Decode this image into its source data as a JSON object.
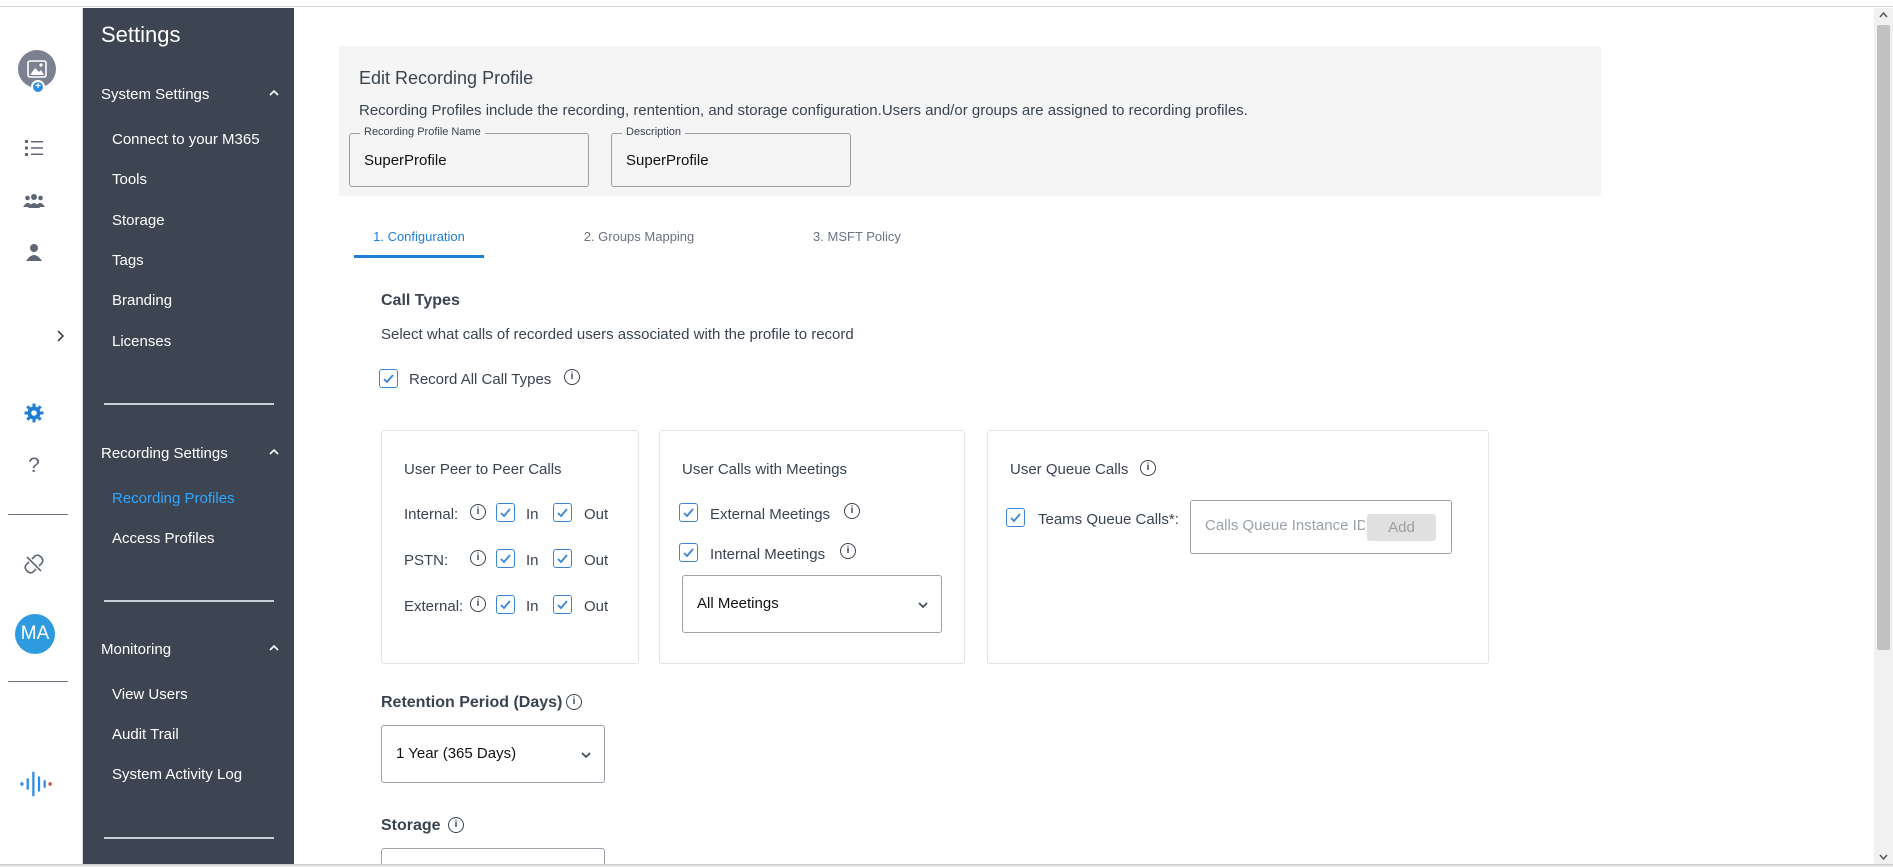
{
  "sidebar": {
    "title": "Settings",
    "system_settings": {
      "label": "System Settings",
      "items": [
        "Connect to your M365",
        "Tools",
        "Storage",
        "Tags",
        "Branding",
        "Licenses"
      ]
    },
    "recording_settings": {
      "label": "Recording Settings",
      "items": [
        "Recording Profiles",
        "Access Profiles"
      ],
      "active": "Recording Profiles"
    },
    "monitoring": {
      "label": "Monitoring",
      "items": [
        "View Users",
        "Audit Trail",
        "System Activity Log"
      ]
    }
  },
  "rail": {
    "avatar_initials": "MA",
    "help_label": "?"
  },
  "header": {
    "title": "Edit Recording Profile",
    "description": "Recording Profiles include the recording, rentention, and storage configuration.Users and/or groups are assigned to recording profiles.",
    "name_label": "Recording Profile Name",
    "name_value": "SuperProfile",
    "desc_label": "Description",
    "desc_value": "SuperProfile"
  },
  "tabs": [
    "1. Configuration",
    "2. Groups Mapping",
    "3. MSFT Policy"
  ],
  "active_tab": "1. Configuration",
  "call_types": {
    "title": "Call Types",
    "subtitle": "Select what calls of recorded users associated with the profile to record",
    "record_all_label": "Record All Call Types",
    "record_all_checked": true
  },
  "peer_calls": {
    "title": "User Peer to Peer Calls",
    "in_label": "In",
    "out_label": "Out",
    "rows": [
      {
        "label": "Internal:",
        "in": true,
        "out": true
      },
      {
        "label": "PSTN:",
        "in": true,
        "out": true
      },
      {
        "label": "External:",
        "in": true,
        "out": true
      }
    ]
  },
  "meeting_calls": {
    "title": "User Calls with Meetings",
    "external_label": "External Meetings",
    "external_checked": true,
    "internal_label": "Internal Meetings",
    "internal_checked": true,
    "select_value": "All Meetings"
  },
  "queue_calls": {
    "title": "User Queue Calls",
    "teams_label": "Teams Queue Calls*:",
    "teams_checked": true,
    "input_placeholder": "Calls Queue Instance ID",
    "add_label": "Add"
  },
  "retention": {
    "title": "Retention Period (Days)",
    "value": "1 Year (365 Days)"
  },
  "storage": {
    "title": "Storage"
  },
  "info_glyph": "i",
  "colors": {
    "sidebar_bg": "#3d4452",
    "accent": "#1f7fd6",
    "active_link": "#2ea7ff",
    "avatar_bg": "#2e9be0"
  }
}
